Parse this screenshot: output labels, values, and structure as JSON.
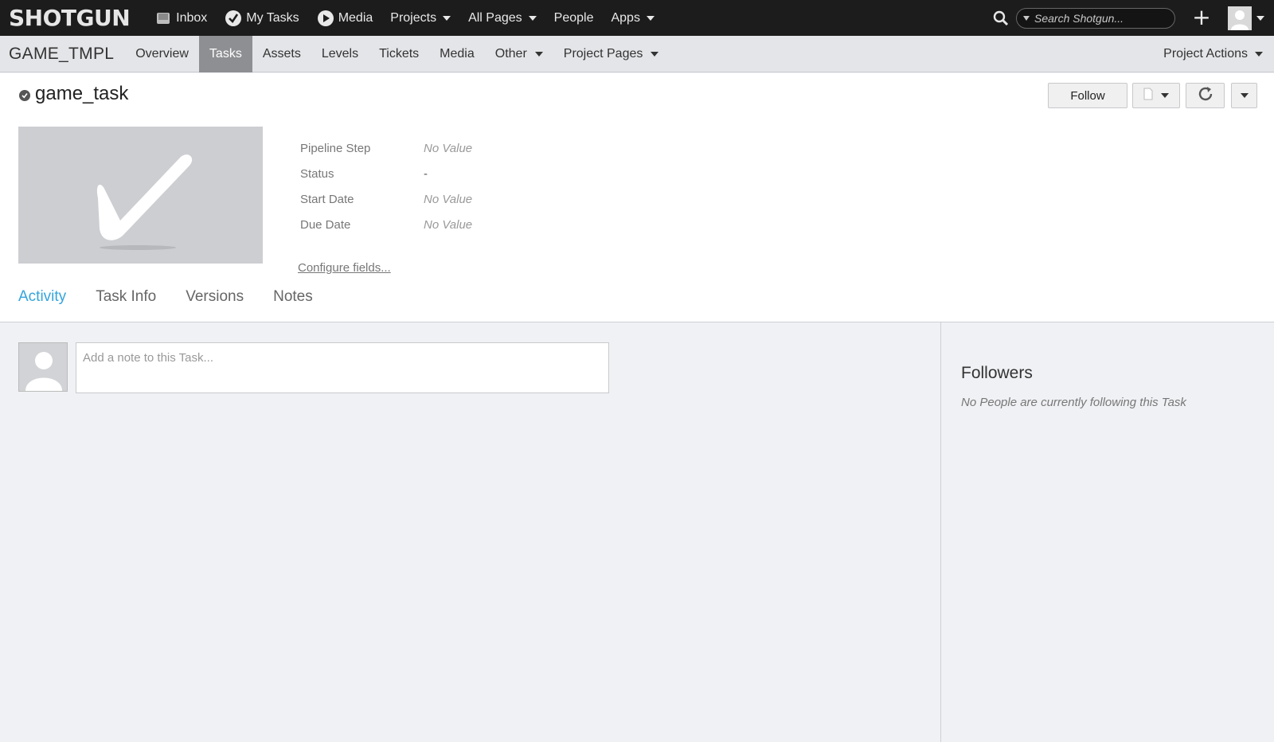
{
  "topbar": {
    "logo": "SHOTGUN",
    "nav": [
      {
        "label": "Inbox",
        "icon": "inbox-icon"
      },
      {
        "label": "My Tasks",
        "icon": "checkmark-circle-icon"
      },
      {
        "label": "Media",
        "icon": "play-circle-icon"
      },
      {
        "label": "Projects",
        "icon": "chevron-down-icon"
      },
      {
        "label": "All Pages",
        "icon": "chevron-down-icon"
      },
      {
        "label": "People"
      },
      {
        "label": "Apps",
        "icon": "chevron-down-icon"
      }
    ],
    "search_placeholder": "Search Shotgun...",
    "add_icon": "plus-icon",
    "user_icon": "user-avatar-icon"
  },
  "projectbar": {
    "name": "GAME_TMPL",
    "tabs": [
      {
        "label": "Overview"
      },
      {
        "label": "Tasks",
        "active": true
      },
      {
        "label": "Assets"
      },
      {
        "label": "Levels"
      },
      {
        "label": "Tickets"
      },
      {
        "label": "Media"
      },
      {
        "label": "Other",
        "dropdown": true
      },
      {
        "label": "Project Pages",
        "dropdown": true
      }
    ],
    "actions_label": "Project Actions"
  },
  "entity": {
    "title": "game_task",
    "follow_label": "Follow",
    "fields": [
      {
        "label": "Pipeline Step",
        "value": "No Value"
      },
      {
        "label": "Status",
        "value": "-"
      },
      {
        "label": "Start Date",
        "value": "No Value"
      },
      {
        "label": "Due Date",
        "value": "No Value"
      }
    ],
    "configure_label": "Configure fields...",
    "tabs": [
      {
        "label": "Activity",
        "active": true
      },
      {
        "label": "Task Info"
      },
      {
        "label": "Versions"
      },
      {
        "label": "Notes"
      }
    ]
  },
  "activity": {
    "note_placeholder": "Add a note to this Task..."
  },
  "followers": {
    "title": "Followers",
    "empty_text": "No People are currently following this Task"
  },
  "colors": {
    "topbar_bg": "#1c1c1c",
    "accent": "#34a4dc",
    "active_tab_bg": "#8e8f92"
  }
}
